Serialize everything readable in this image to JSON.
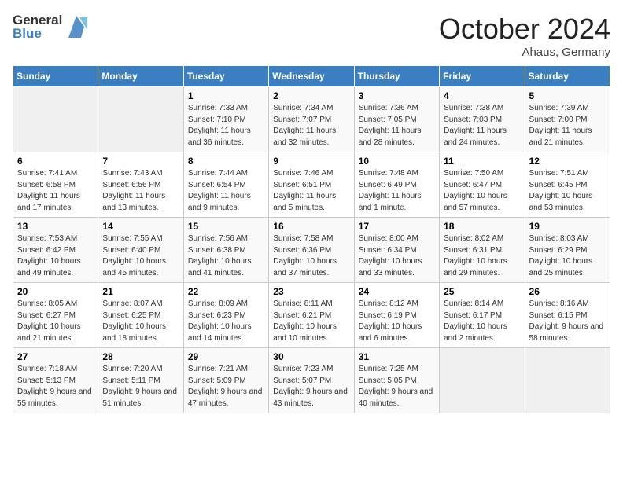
{
  "header": {
    "logo_line1": "General",
    "logo_line2": "Blue",
    "month": "October 2024",
    "location": "Ahaus, Germany"
  },
  "weekdays": [
    "Sunday",
    "Monday",
    "Tuesday",
    "Wednesday",
    "Thursday",
    "Friday",
    "Saturday"
  ],
  "weeks": [
    [
      {
        "day": "",
        "detail": ""
      },
      {
        "day": "",
        "detail": ""
      },
      {
        "day": "1",
        "detail": "Sunrise: 7:33 AM\nSunset: 7:10 PM\nDaylight: 11 hours and 36 minutes."
      },
      {
        "day": "2",
        "detail": "Sunrise: 7:34 AM\nSunset: 7:07 PM\nDaylight: 11 hours and 32 minutes."
      },
      {
        "day": "3",
        "detail": "Sunrise: 7:36 AM\nSunset: 7:05 PM\nDaylight: 11 hours and 28 minutes."
      },
      {
        "day": "4",
        "detail": "Sunrise: 7:38 AM\nSunset: 7:03 PM\nDaylight: 11 hours and 24 minutes."
      },
      {
        "day": "5",
        "detail": "Sunrise: 7:39 AM\nSunset: 7:00 PM\nDaylight: 11 hours and 21 minutes."
      }
    ],
    [
      {
        "day": "6",
        "detail": "Sunrise: 7:41 AM\nSunset: 6:58 PM\nDaylight: 11 hours and 17 minutes."
      },
      {
        "day": "7",
        "detail": "Sunrise: 7:43 AM\nSunset: 6:56 PM\nDaylight: 11 hours and 13 minutes."
      },
      {
        "day": "8",
        "detail": "Sunrise: 7:44 AM\nSunset: 6:54 PM\nDaylight: 11 hours and 9 minutes."
      },
      {
        "day": "9",
        "detail": "Sunrise: 7:46 AM\nSunset: 6:51 PM\nDaylight: 11 hours and 5 minutes."
      },
      {
        "day": "10",
        "detail": "Sunrise: 7:48 AM\nSunset: 6:49 PM\nDaylight: 11 hours and 1 minute."
      },
      {
        "day": "11",
        "detail": "Sunrise: 7:50 AM\nSunset: 6:47 PM\nDaylight: 10 hours and 57 minutes."
      },
      {
        "day": "12",
        "detail": "Sunrise: 7:51 AM\nSunset: 6:45 PM\nDaylight: 10 hours and 53 minutes."
      }
    ],
    [
      {
        "day": "13",
        "detail": "Sunrise: 7:53 AM\nSunset: 6:42 PM\nDaylight: 10 hours and 49 minutes."
      },
      {
        "day": "14",
        "detail": "Sunrise: 7:55 AM\nSunset: 6:40 PM\nDaylight: 10 hours and 45 minutes."
      },
      {
        "day": "15",
        "detail": "Sunrise: 7:56 AM\nSunset: 6:38 PM\nDaylight: 10 hours and 41 minutes."
      },
      {
        "day": "16",
        "detail": "Sunrise: 7:58 AM\nSunset: 6:36 PM\nDaylight: 10 hours and 37 minutes."
      },
      {
        "day": "17",
        "detail": "Sunrise: 8:00 AM\nSunset: 6:34 PM\nDaylight: 10 hours and 33 minutes."
      },
      {
        "day": "18",
        "detail": "Sunrise: 8:02 AM\nSunset: 6:31 PM\nDaylight: 10 hours and 29 minutes."
      },
      {
        "day": "19",
        "detail": "Sunrise: 8:03 AM\nSunset: 6:29 PM\nDaylight: 10 hours and 25 minutes."
      }
    ],
    [
      {
        "day": "20",
        "detail": "Sunrise: 8:05 AM\nSunset: 6:27 PM\nDaylight: 10 hours and 21 minutes."
      },
      {
        "day": "21",
        "detail": "Sunrise: 8:07 AM\nSunset: 6:25 PM\nDaylight: 10 hours and 18 minutes."
      },
      {
        "day": "22",
        "detail": "Sunrise: 8:09 AM\nSunset: 6:23 PM\nDaylight: 10 hours and 14 minutes."
      },
      {
        "day": "23",
        "detail": "Sunrise: 8:11 AM\nSunset: 6:21 PM\nDaylight: 10 hours and 10 minutes."
      },
      {
        "day": "24",
        "detail": "Sunrise: 8:12 AM\nSunset: 6:19 PM\nDaylight: 10 hours and 6 minutes."
      },
      {
        "day": "25",
        "detail": "Sunrise: 8:14 AM\nSunset: 6:17 PM\nDaylight: 10 hours and 2 minutes."
      },
      {
        "day": "26",
        "detail": "Sunrise: 8:16 AM\nSunset: 6:15 PM\nDaylight: 9 hours and 58 minutes."
      }
    ],
    [
      {
        "day": "27",
        "detail": "Sunrise: 7:18 AM\nSunset: 5:13 PM\nDaylight: 9 hours and 55 minutes."
      },
      {
        "day": "28",
        "detail": "Sunrise: 7:20 AM\nSunset: 5:11 PM\nDaylight: 9 hours and 51 minutes."
      },
      {
        "day": "29",
        "detail": "Sunrise: 7:21 AM\nSunset: 5:09 PM\nDaylight: 9 hours and 47 minutes."
      },
      {
        "day": "30",
        "detail": "Sunrise: 7:23 AM\nSunset: 5:07 PM\nDaylight: 9 hours and 43 minutes."
      },
      {
        "day": "31",
        "detail": "Sunrise: 7:25 AM\nSunset: 5:05 PM\nDaylight: 9 hours and 40 minutes."
      },
      {
        "day": "",
        "detail": ""
      },
      {
        "day": "",
        "detail": ""
      }
    ]
  ]
}
